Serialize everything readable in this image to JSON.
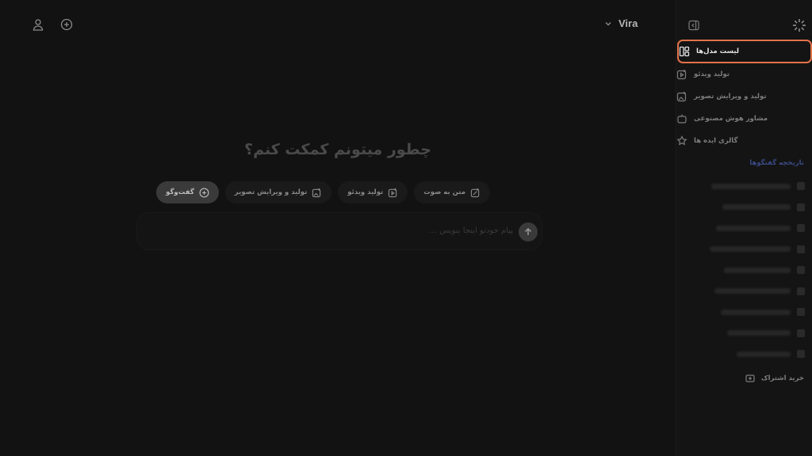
{
  "header": {
    "model_name": "Vira",
    "icons": [
      "user-icon",
      "new-chat-icon",
      "chevron-down-icon"
    ]
  },
  "main": {
    "title": "چطور میتونم کمکت کنم؟",
    "chips": [
      {
        "label": "گفت‌وگو",
        "icon": "chat-icon",
        "active": true
      },
      {
        "label": "تولید و ویرایش تصویر",
        "icon": "image-edit-icon",
        "active": false
      },
      {
        "label": "تولید ویدئو",
        "icon": "video-icon",
        "active": false
      },
      {
        "label": "متن به صوت",
        "icon": "text-to-speech-icon",
        "active": false
      }
    ],
    "composer_placeholder": "پیام خودتو اینجا بنویس ..."
  },
  "sidebar": {
    "nav": [
      {
        "label": "لیست مدل‌ها",
        "icon": "models-grid-icon",
        "active": true
      },
      {
        "label": "تولید ویدئو",
        "icon": "video-icon",
        "active": false
      },
      {
        "label": "تولید و ویرایش تصویر",
        "icon": "image-edit-icon",
        "active": false
      },
      {
        "label": "مشاور هوش مصنوعی",
        "icon": "robot-icon",
        "active": false
      },
      {
        "label": "گالری ایده ها",
        "icon": "gallery-icon",
        "active": false
      }
    ],
    "history_title": "تاریخچه گفتگوها",
    "subscribe_label": "خرید اشتراک",
    "accent": "#e2734a",
    "history_title_color": "#3a4a86"
  }
}
